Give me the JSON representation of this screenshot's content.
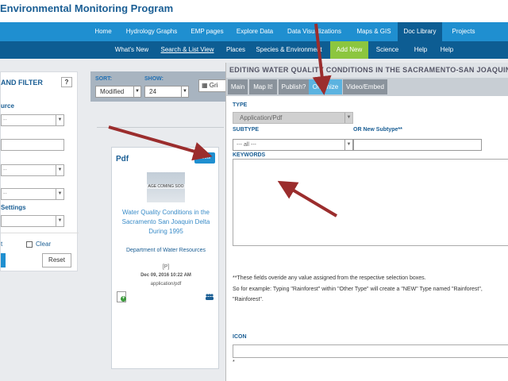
{
  "site_title": "Environmental Monitoring Program",
  "nav_primary": [
    "Home",
    "Hydrology Graphs",
    "EMP pages",
    "Explore Data",
    "Data Visualizations",
    "Maps & GIS",
    "Doc Library",
    "Projects"
  ],
  "nav_secondary": [
    "What's New",
    "Search & List View",
    "Places",
    "Species & Environment",
    "Add New",
    "Science",
    "Help",
    "Help"
  ],
  "filter": {
    "title": "AND FILTER",
    "help_label": "?",
    "source_label": "urce",
    "select_placeholder": "--",
    "settings_label": "Settings",
    "select_label": "t",
    "clear_label": "Clear",
    "reset_label": "Reset"
  },
  "toolbar": {
    "sort_label": "SORT:",
    "sort_value": "Modified",
    "show_label": "SHOW:",
    "show_value": "24",
    "grid_label": "Gri"
  },
  "card": {
    "type": "Pdf",
    "tools_label": "Tools",
    "image_text": "AGE COMING SOO",
    "title": "Water Quality Conditions in the Sacramento San Joaquin Delta During 1995",
    "org": "Department of Water Resources",
    "flag": "[P]",
    "date": "Dec 09, 2016 10:22 AM",
    "format": "application/pdf",
    "add_icon": "+"
  },
  "modal": {
    "title": "EDITING WATER QUALITY CONDITIONS IN THE SACRAMENTO-SAN JOAQUIN DE",
    "tabs": [
      "Main",
      "Map It!",
      "Publish?",
      "Organize",
      "Video/Embed"
    ],
    "type_label": "TYPE",
    "type_value": "Application/Pdf",
    "subtype_label": "SUBTYPE",
    "new_subtype_label": "OR New Subtype**",
    "subtype_value": "--- all ---",
    "keywords_label": "KEYWORDS",
    "note_1": "**These fields overide any value assigned from the respective selection boxes.",
    "note_2": "So for example: Typing \"Rainforest\" within \"Other Type\" will create a \"NEW\" Type named \"Rainforest\",",
    "note_3": "\"Rainforest\".",
    "icon_label": "ICON",
    "icon_note": "*"
  },
  "colors": {
    "nav_primary": "#1f8fd0",
    "nav_secondary": "#0d5d93",
    "add_new": "#8cc63f",
    "active_tab": "#5bb3e0",
    "annotation_arrow": "#9b2d2d"
  },
  "icons": [
    "chevron-down-icon",
    "grid-icon",
    "add-document-icon",
    "people-icon",
    "annotation-arrow"
  ]
}
